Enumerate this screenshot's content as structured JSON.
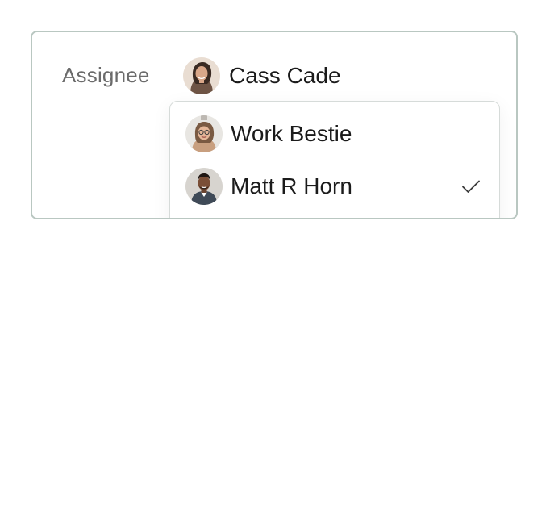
{
  "assignee_field": {
    "label": "Assignee",
    "selected": {
      "name": "Cass Cade",
      "avatar_icon": "person-avatar-cass-cade"
    }
  },
  "dropdown": {
    "options": [
      {
        "name": "Work Bestie",
        "avatar_icon": "person-avatar-work-bestie",
        "checked": false
      },
      {
        "name": "Matt R Horn",
        "avatar_icon": "person-avatar-matt-r-horn",
        "checked": true
      }
    ]
  },
  "colors": {
    "card_border": "#b9c7c1",
    "dropdown_border": "#d6dbd9",
    "label_text": "#6b6b6b",
    "text": "#1b1b1b"
  }
}
